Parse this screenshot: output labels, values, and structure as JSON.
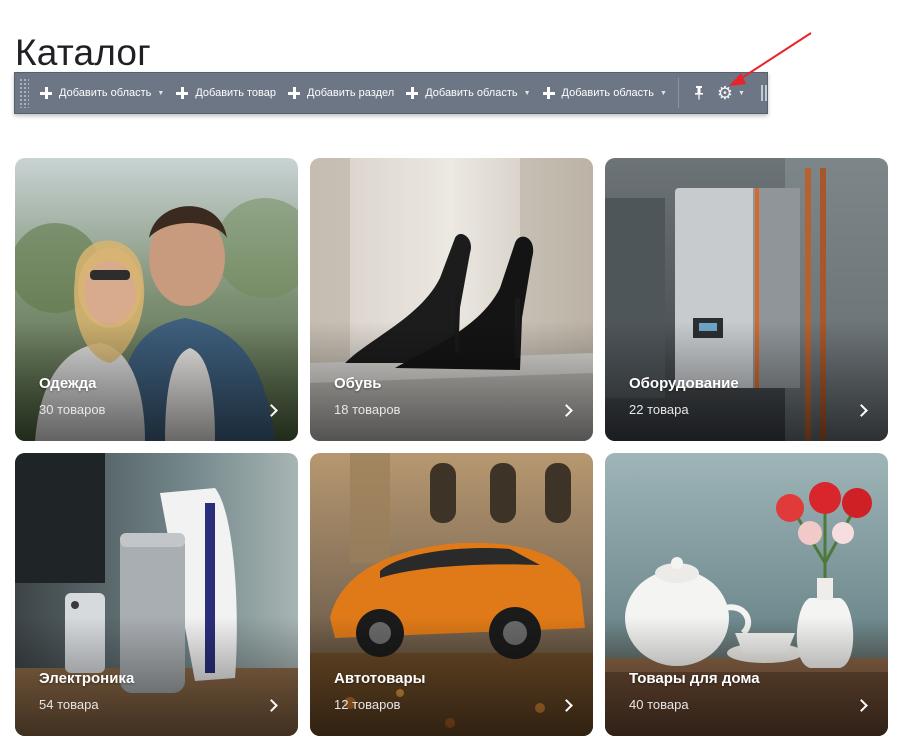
{
  "page": {
    "title": "Каталог"
  },
  "toolbar": {
    "items": [
      {
        "label": "Добавить область",
        "has_caret": true
      },
      {
        "label": "Добавить товар",
        "has_caret": false
      },
      {
        "label": "Добавить раздел",
        "has_caret": false
      },
      {
        "label": "Добавить область",
        "has_caret": true
      },
      {
        "label": "Добавить область",
        "has_caret": true
      }
    ],
    "icons": [
      "pin-icon",
      "gear-icon",
      "chevron-down-icon"
    ]
  },
  "annotation": {
    "color": "#e8232a"
  },
  "catalog": {
    "cards": [
      {
        "name": "Одежда",
        "count": "30 товаров"
      },
      {
        "name": "Обувь",
        "count": "18 товаров"
      },
      {
        "name": "Оборудование",
        "count": "22 товара"
      },
      {
        "name": "Электроника",
        "count": "54 товара"
      },
      {
        "name": "Автотовары",
        "count": "12 товаров"
      },
      {
        "name": "Товары для дома",
        "count": "40 товара"
      }
    ]
  },
  "colors": {
    "toolbar_bg": "#6c7684",
    "title": "#1f2024"
  }
}
